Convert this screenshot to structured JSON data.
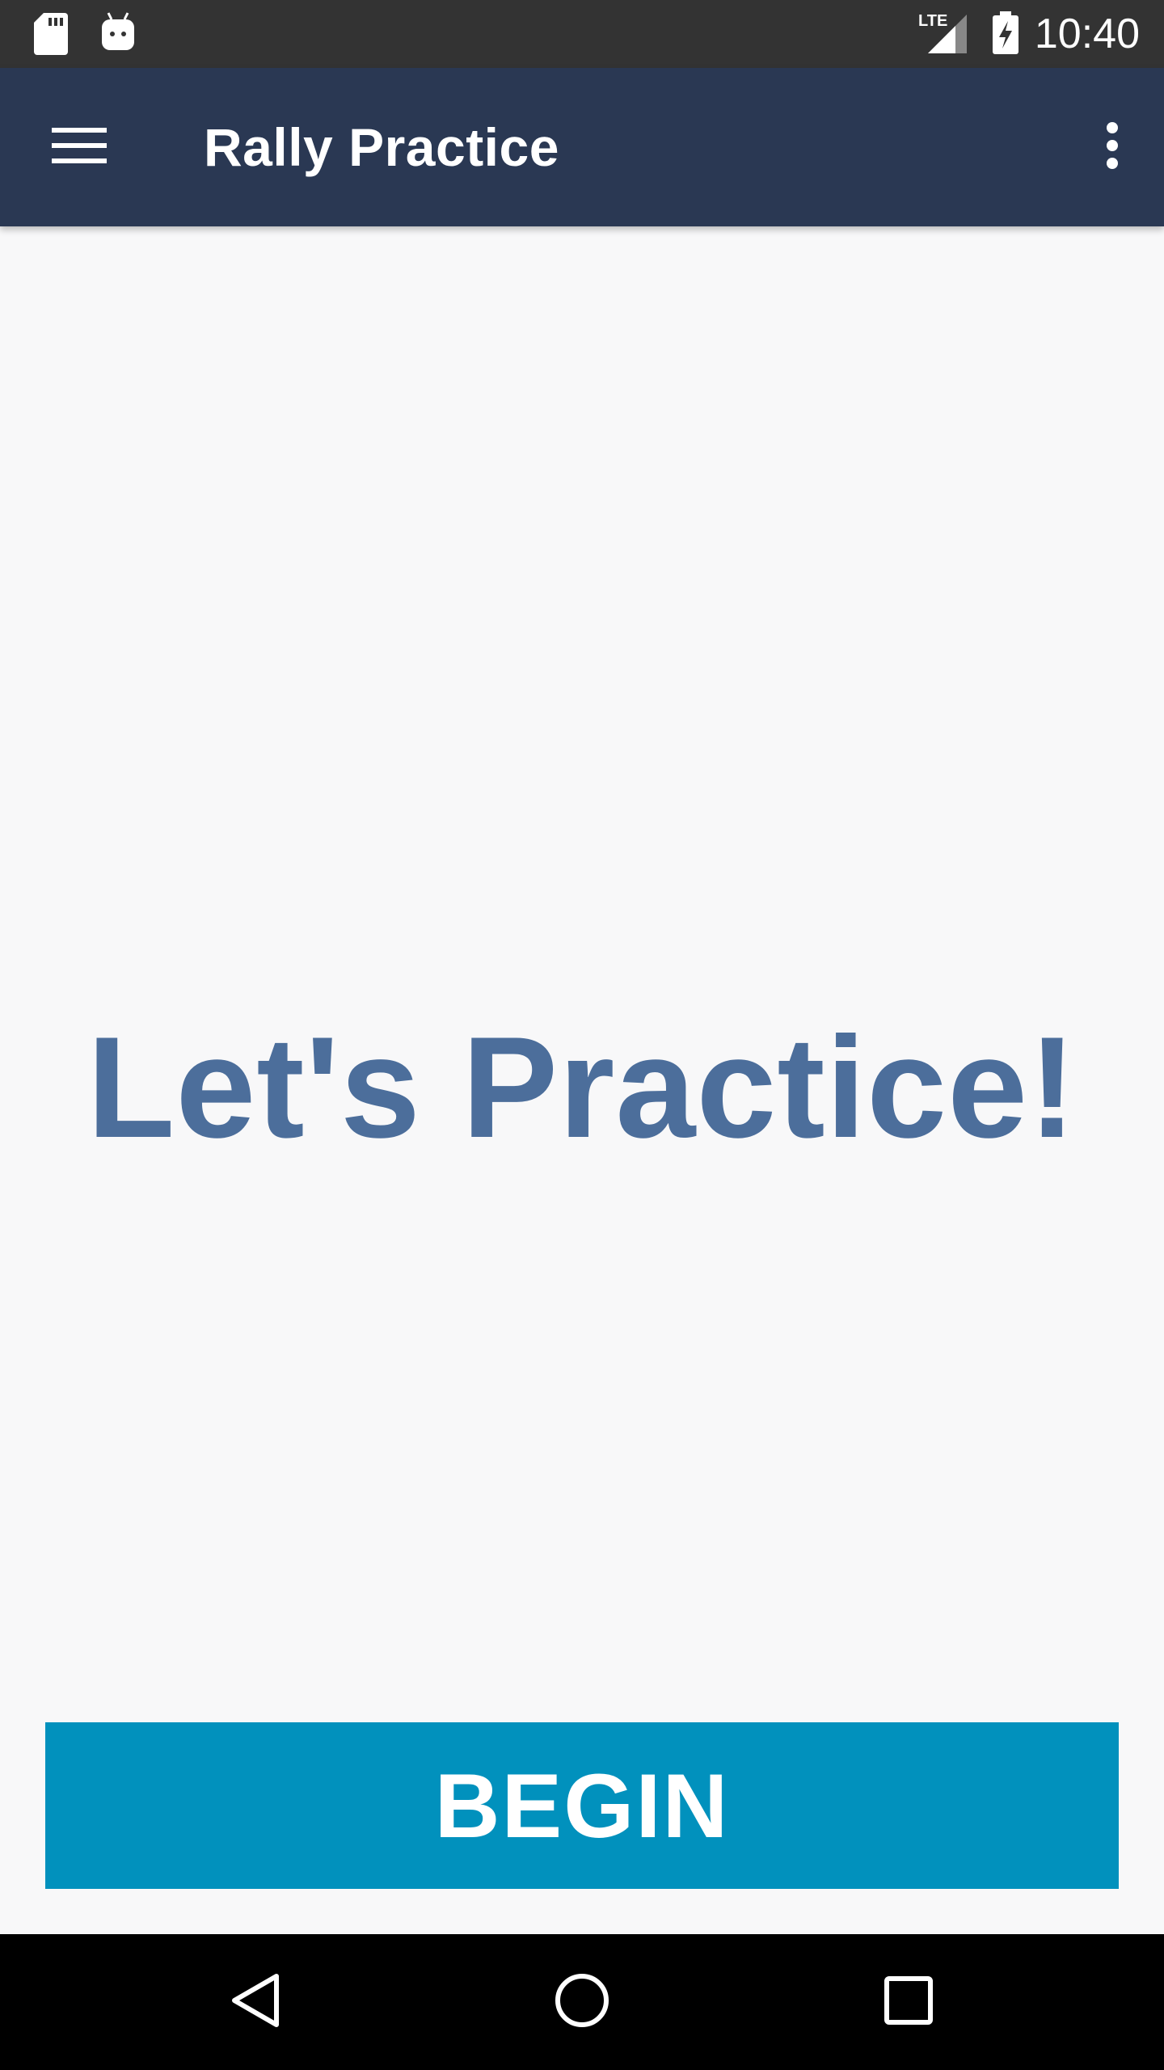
{
  "status_bar": {
    "time": "10:40",
    "network_label": "LTE",
    "icons": [
      "sd-card-icon",
      "android-icon",
      "lte-signal-icon",
      "battery-charging-icon"
    ]
  },
  "app_bar": {
    "title": "Rally Practice",
    "menu_icon": "hamburger-menu-icon",
    "overflow_icon": "more-vert-icon"
  },
  "main": {
    "headline": "Let's Practice!",
    "begin_label": "BEGIN"
  },
  "nav_bar": {
    "icons": [
      "back-icon",
      "home-icon",
      "recents-icon"
    ]
  },
  "colors": {
    "status_bar": "#333333",
    "app_bar": "#2a3853",
    "background": "#f8f8f9",
    "headline": "#4c6e9b",
    "button": "#0191bd",
    "nav_bar": "#000000"
  }
}
